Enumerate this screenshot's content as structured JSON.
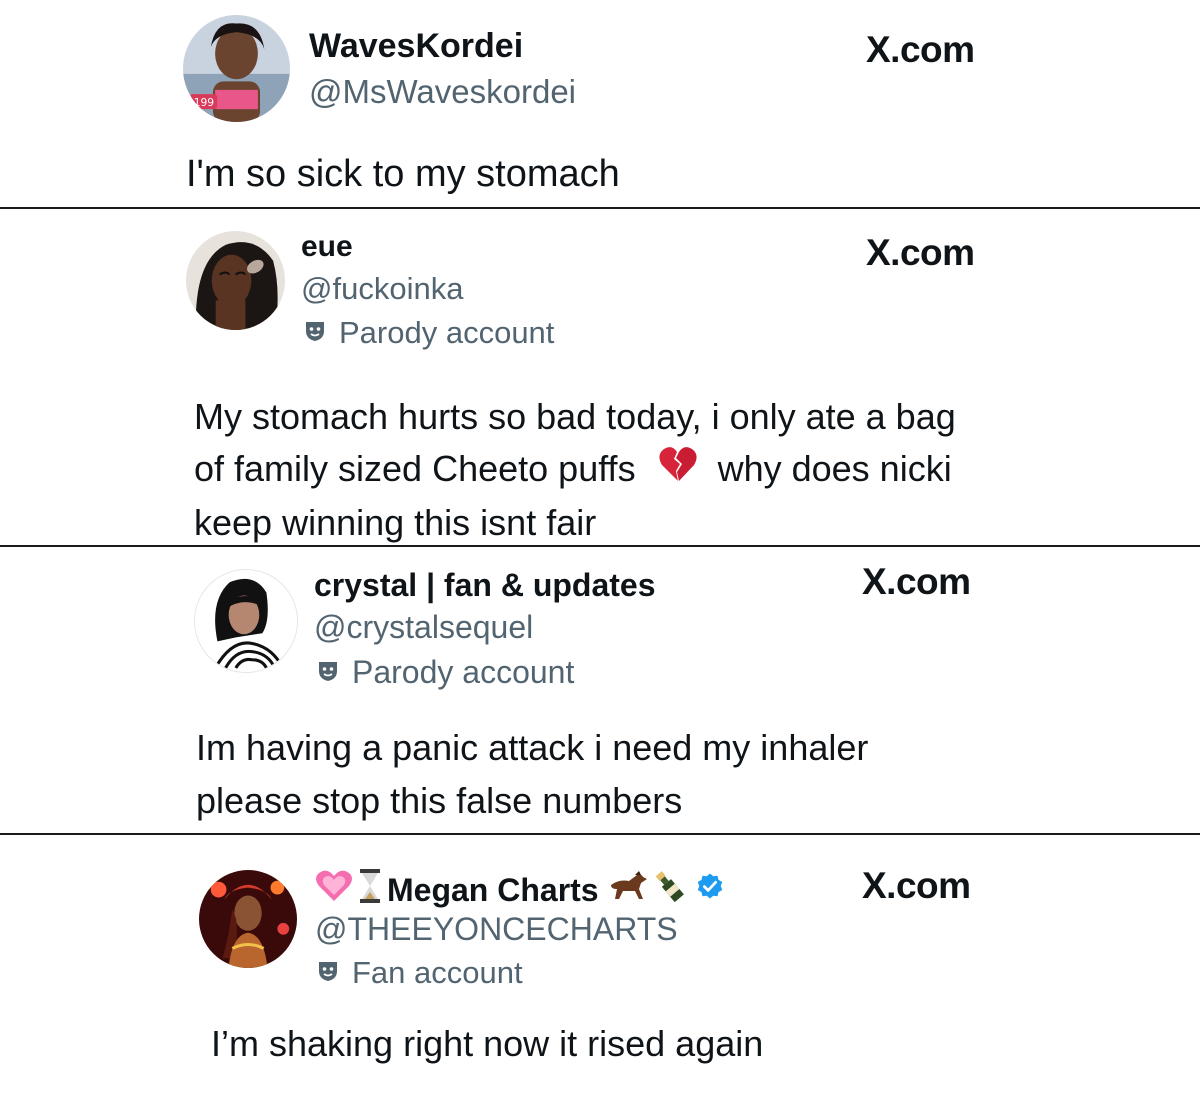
{
  "site_label": "X.com",
  "posts": [
    {
      "display_name": "WavesKordei",
      "handle": "@MsWaveskordei",
      "account_label": "",
      "text_lines": [
        "I'm so sick to my stomach"
      ]
    },
    {
      "display_name": "eue",
      "handle": "@fuckoinka",
      "account_label": "Parody account",
      "text_lines": [
        "My stomach hurts so bad today, i only ate a bag",
        "of family sized Cheeto puffs",
        "why does nicki",
        "keep winning this isnt fair"
      ]
    },
    {
      "display_name": "crystal | fan & updates",
      "handle": "@crystalsequel",
      "account_label": "Parody account",
      "text_lines": [
        "Im having a panic attack i need my inhaler",
        "please stop this false numbers"
      ]
    },
    {
      "display_name": "Megan Charts",
      "handle": "@THEEYONCECHARTS",
      "account_label": "Fan account",
      "text_lines": [
        "I’m shaking right now it rised again"
      ]
    }
  ],
  "colors": {
    "text": "#0f1419",
    "secondary": "#536471",
    "verified": "#1d9bf0",
    "divider": "#1a1a1a"
  },
  "icons": {
    "mask": "parody-mask-icon",
    "broken_heart": "broken-heart-emoji",
    "verified": "verified-badge-icon"
  }
}
